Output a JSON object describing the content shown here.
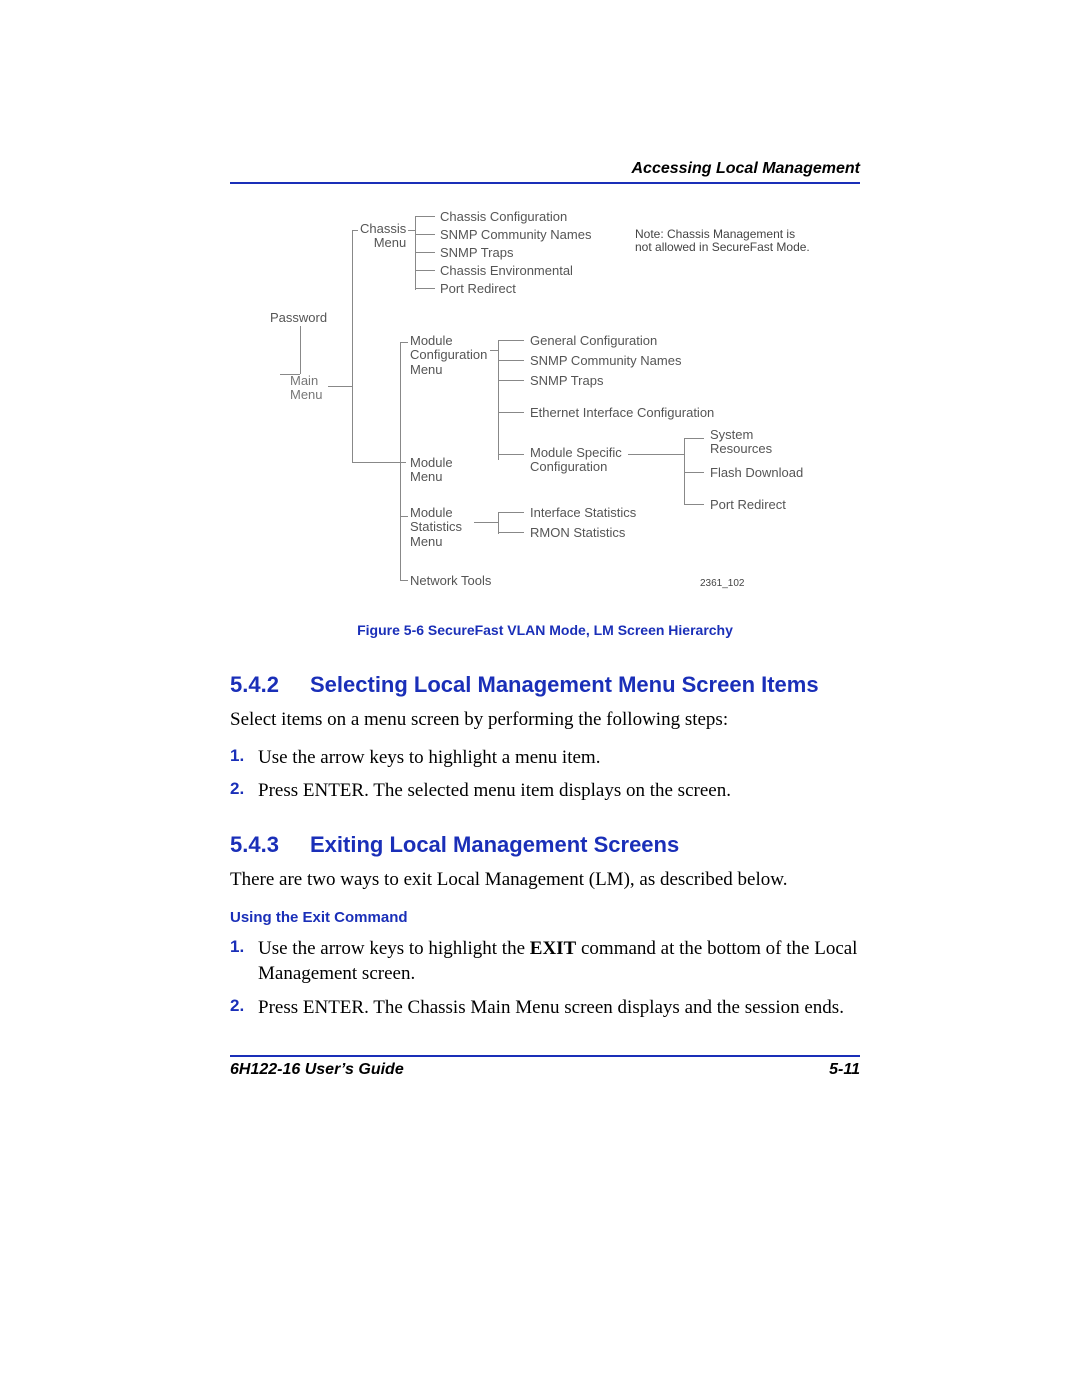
{
  "header": {
    "running": "Accessing Local Management"
  },
  "diagram": {
    "password": "Password",
    "main_menu": "Main\nMenu",
    "chassis_menu": "Chassis\nMenu",
    "module_config_menu": "Module\nConfiguration\nMenu",
    "module_menu": "Module\nMenu",
    "module_stats_menu": "Module\nStatistics\nMenu",
    "network_tools": "Network Tools",
    "chassis_items": [
      "Chassis Configuration",
      "SNMP Community Names",
      "SNMP Traps",
      "Chassis Environmental",
      "Port Redirect"
    ],
    "note": "Note: Chassis Management is\nnot allowed in SecureFast Mode.",
    "module_config_items": [
      "General Configuration",
      "SNMP Community Names",
      "SNMP Traps",
      "Ethernet Interface Configuration"
    ],
    "module_specific_label": "Module Specific\nConfiguration",
    "module_specific_items": [
      "System\nResources",
      "Flash Download",
      "Port Redirect"
    ],
    "stats_items": [
      "Interface Statistics",
      "RMON Statistics"
    ],
    "doc_id": "2361_102"
  },
  "caption": "Figure 5-6   SecureFast VLAN Mode, LM Screen Hierarchy",
  "section1": {
    "num": "5.4.2",
    "title": "Selecting Local Management Menu Screen Items",
    "intro": "Select items on a menu screen by performing the following steps:",
    "steps": [
      "Use the arrow keys to highlight a menu item.",
      "Press ENTER. The selected menu item displays on the screen."
    ]
  },
  "section2": {
    "num": "5.4.3",
    "title": "Exiting Local Management Screens",
    "intro": "There are two ways to exit Local Management (LM), as described below.",
    "sub_heading": "Using the Exit Command",
    "step1_pre": "Use the arrow keys to highlight the ",
    "step1_bold": "EXIT",
    "step1_post": " command at the bottom of the Local Management screen.",
    "step2": "Press ENTER. The Chassis Main Menu screen displays and the session ends."
  },
  "footer": {
    "left": "6H122-16 User’s Guide",
    "right": "5-11"
  }
}
